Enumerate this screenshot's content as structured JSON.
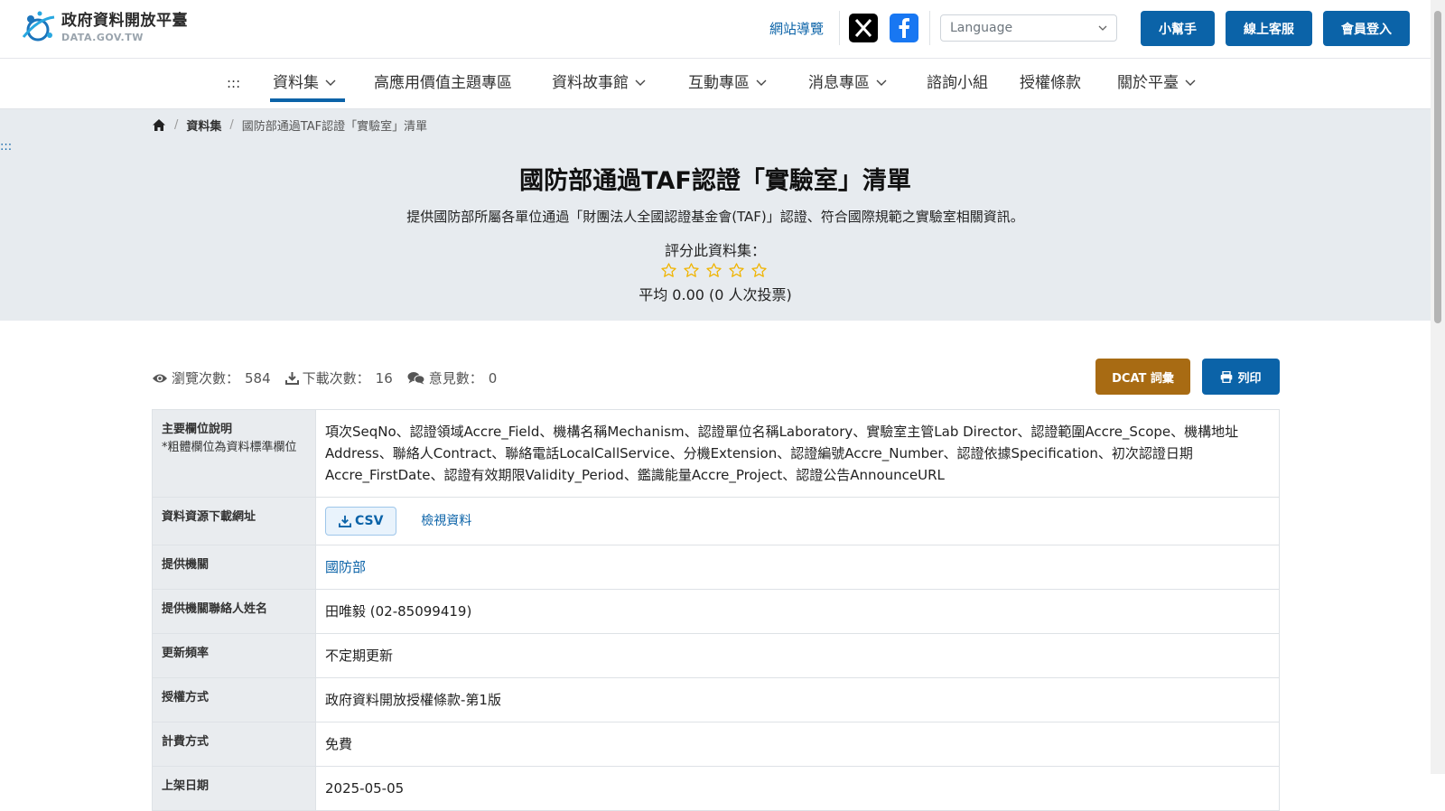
{
  "header": {
    "logo_title": "政府資料開放平臺",
    "logo_sub": "DATA.GOV.TW",
    "sitemap": "網站導覽",
    "language_placeholder": "Language",
    "helper": "小幫手",
    "support": "線上客服",
    "login": "會員登入"
  },
  "nav": {
    "skip": ":::",
    "items": [
      "資料集",
      "高應用價值主題專區",
      "資料故事館",
      "互動專區",
      "消息專區",
      "諮詢小組",
      "授權條款",
      "關於平臺"
    ]
  },
  "breadcrumb": {
    "level1": "資料集",
    "current": "國防部通過TAF認證「實驗室」清單"
  },
  "dataset": {
    "skip": ":::",
    "title": "國防部通過TAF認證「實驗室」清單",
    "description": "提供國防部所屬各單位通過「財團法人全國認證基金會(TAF)」認證、符合國際規範之實驗室相關資訊。",
    "rate_label": "評分此資料集：",
    "rating": 0,
    "average": "平均 0.00 (0 人次投票)"
  },
  "stats": {
    "views_label": "瀏覽次數：",
    "views": "584",
    "downloads_label": "下載次數：",
    "downloads": "16",
    "comments_label": "意見數：",
    "comments": "0"
  },
  "actions": {
    "dcat": "DCAT 詞彙",
    "print": "列印"
  },
  "table": {
    "fields_label": "主要欄位說明",
    "fields_note": "*粗體欄位為資料標準欄位",
    "fields_value": "項次SeqNo、認證領域Accre_Field、機構名稱Mechanism、認證單位名稱Laboratory、實驗室主管Lab Director、認證範圍Accre_Scope、機構地址Address、聯絡人Contract、聯絡電話LocalCallService、分機Extension、認證編號Accre_Number、認證依據Specification、初次認證日期Accre_FirstDate、認證有效期限Validity_Period、鑑識能量Accre_Project、認證公告AnnounceURL",
    "download_label": "資料資源下載網址",
    "csv": "CSV",
    "view_data": "檢視資料",
    "agency_label": "提供機關",
    "agency": "國防部",
    "contact_label": "提供機關聯絡人姓名",
    "contact": "田唯毅 (02-85099419)",
    "frequency_label": "更新頻率",
    "frequency": "不定期更新",
    "license_label": "授權方式",
    "license": "政府資料開放授權條款-第1版",
    "fee_label": "計費方式",
    "fee": "免費",
    "listed_label": "上架日期",
    "listed": "2025-05-05"
  },
  "colors": {
    "primary": "#0b63a8",
    "dcat": "#a86b13",
    "hero_bg": "#e7ebef",
    "star": "#f0b400"
  }
}
